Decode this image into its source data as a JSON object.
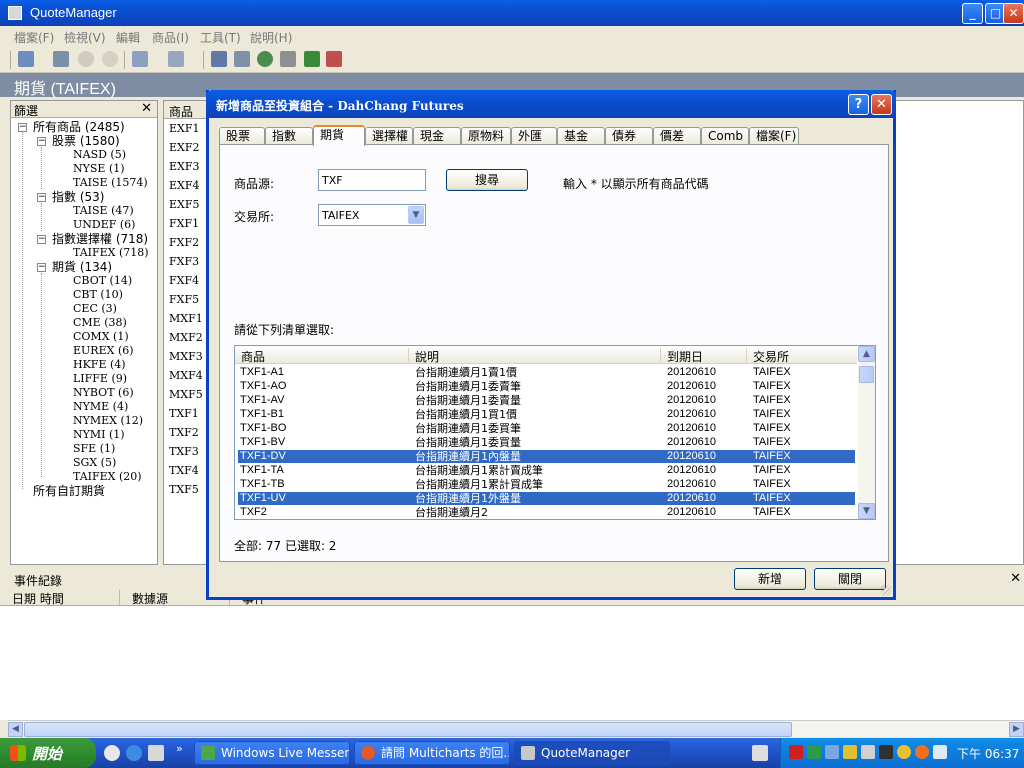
{
  "window": {
    "title": "QuoteManager",
    "controls": {
      "minimize": "_",
      "maximize": "□",
      "close": "✕"
    }
  },
  "menu": [
    "檔案(F)",
    "檢視(V)",
    "編輯",
    "商品(I)",
    "工具(T)",
    "說明(H)"
  ],
  "section_title": "期貨 (TAIFEX)",
  "filter_panel": {
    "title": "篩選",
    "close": "✕",
    "tree": [
      {
        "label": "所有商品 (2485)"
      },
      {
        "label": "股票 (1580)"
      },
      {
        "label": "NASD (5)"
      },
      {
        "label": "NYSE (1)"
      },
      {
        "label": "TAISE (1574)"
      },
      {
        "label": "指數 (53)"
      },
      {
        "label": "TAISE (47)"
      },
      {
        "label": "UNDEF (6)"
      },
      {
        "label": "指數選擇權 (718)"
      },
      {
        "label": "TAIFEX (718)"
      },
      {
        "label": "期貨 (134)"
      },
      {
        "label": "CBOT (14)"
      },
      {
        "label": "CBT (10)"
      },
      {
        "label": "CEC (3)"
      },
      {
        "label": "CME (38)"
      },
      {
        "label": "COMX (1)"
      },
      {
        "label": "EUREX (6)"
      },
      {
        "label": "HKFE (4)"
      },
      {
        "label": "LIFFE (9)"
      },
      {
        "label": "NYBOT (6)"
      },
      {
        "label": "NYME (4)"
      },
      {
        "label": "NYMEX (12)"
      },
      {
        "label": "NYMI (1)"
      },
      {
        "label": "SFE (1)"
      },
      {
        "label": "SGX (5)"
      },
      {
        "label": "TAIFEX (20)"
      },
      {
        "label": "所有自訂期貨"
      }
    ]
  },
  "symbol_panel": {
    "header": "商品",
    "rows": [
      "EXF1",
      "EXF2",
      "EXF3",
      "EXF4",
      "EXF5",
      "FXF1",
      "FXF2",
      "FXF3",
      "FXF4",
      "FXF5",
      "MXF1",
      "MXF2",
      "MXF3",
      "MXF4",
      "MXF5",
      "TXF1",
      "TXF2",
      "TXF3",
      "TXF4",
      "TXF5"
    ]
  },
  "event_panel": {
    "title": "事件紀錄",
    "close": "✕",
    "columns": [
      "日期 時間",
      "數據源",
      "事件"
    ]
  },
  "dialog": {
    "title": "新增商品至投資組合 - DahChang Futures",
    "help": "?",
    "close": "✕",
    "tabs": [
      "股票",
      "指數",
      "期貨",
      "選擇權",
      "現金",
      "原物料",
      "外匯",
      "基金",
      "債券",
      "價差",
      "Comb",
      "檔案(F)"
    ],
    "active_tab": "期貨",
    "source_label": "商品源:",
    "source_value": "TXF",
    "search_button": "搜尋",
    "hint": "輸入 * 以顯示所有商品代碼",
    "exchange_label": "交易所:",
    "exchange_value": "TAIFEX",
    "list_prompt": "請從下列清單選取:",
    "list_columns": [
      "商品",
      "說明",
      "到期日",
      "交易所"
    ],
    "list_rows": [
      {
        "symbol": "TXF1-A1",
        "desc": "台指期連續月1賣1價",
        "expiry": "20120610",
        "exchange": "TAIFEX",
        "selected": false
      },
      {
        "symbol": "TXF1-AO",
        "desc": "台指期連續月1委賣筆",
        "expiry": "20120610",
        "exchange": "TAIFEX",
        "selected": false
      },
      {
        "symbol": "TXF1-AV",
        "desc": "台指期連續月1委賣量",
        "expiry": "20120610",
        "exchange": "TAIFEX",
        "selected": false
      },
      {
        "symbol": "TXF1-B1",
        "desc": "台指期連續月1買1價",
        "expiry": "20120610",
        "exchange": "TAIFEX",
        "selected": false
      },
      {
        "symbol": "TXF1-BO",
        "desc": "台指期連續月1委買筆",
        "expiry": "20120610",
        "exchange": "TAIFEX",
        "selected": false
      },
      {
        "symbol": "TXF1-BV",
        "desc": "台指期連續月1委買量",
        "expiry": "20120610",
        "exchange": "TAIFEX",
        "selected": false
      },
      {
        "symbol": "TXF1-DV",
        "desc": "台指期連續月1內盤量",
        "expiry": "20120610",
        "exchange": "TAIFEX",
        "selected": true
      },
      {
        "symbol": "TXF1-TA",
        "desc": "台指期連續月1累計賣成筆",
        "expiry": "20120610",
        "exchange": "TAIFEX",
        "selected": false
      },
      {
        "symbol": "TXF1-TB",
        "desc": "台指期連續月1累計買成筆",
        "expiry": "20120610",
        "exchange": "TAIFEX",
        "selected": false
      },
      {
        "symbol": "TXF1-UV",
        "desc": "台指期連續月1外盤量",
        "expiry": "20120610",
        "exchange": "TAIFEX",
        "selected": true
      },
      {
        "symbol": "TXF2",
        "desc": "台指期連續月2",
        "expiry": "20120610",
        "exchange": "TAIFEX",
        "selected": false
      }
    ],
    "status": "全部: 77   已選取: 2",
    "add_button": "新增",
    "close_button": "關閉"
  },
  "taskbar": {
    "start": "開始",
    "tasks": [
      {
        "label": "Windows Live Messen...",
        "active": false
      },
      {
        "label": "請問 Multicharts 的回...",
        "active": false
      },
      {
        "label": "QuoteManager",
        "active": true
      }
    ],
    "clock": "下午 06:37"
  },
  "colors": {
    "title_blue": "#0a4fd0",
    "selection": "#316ac5",
    "section_header": "#7f8da4",
    "start_green": "#2f8c2f"
  }
}
